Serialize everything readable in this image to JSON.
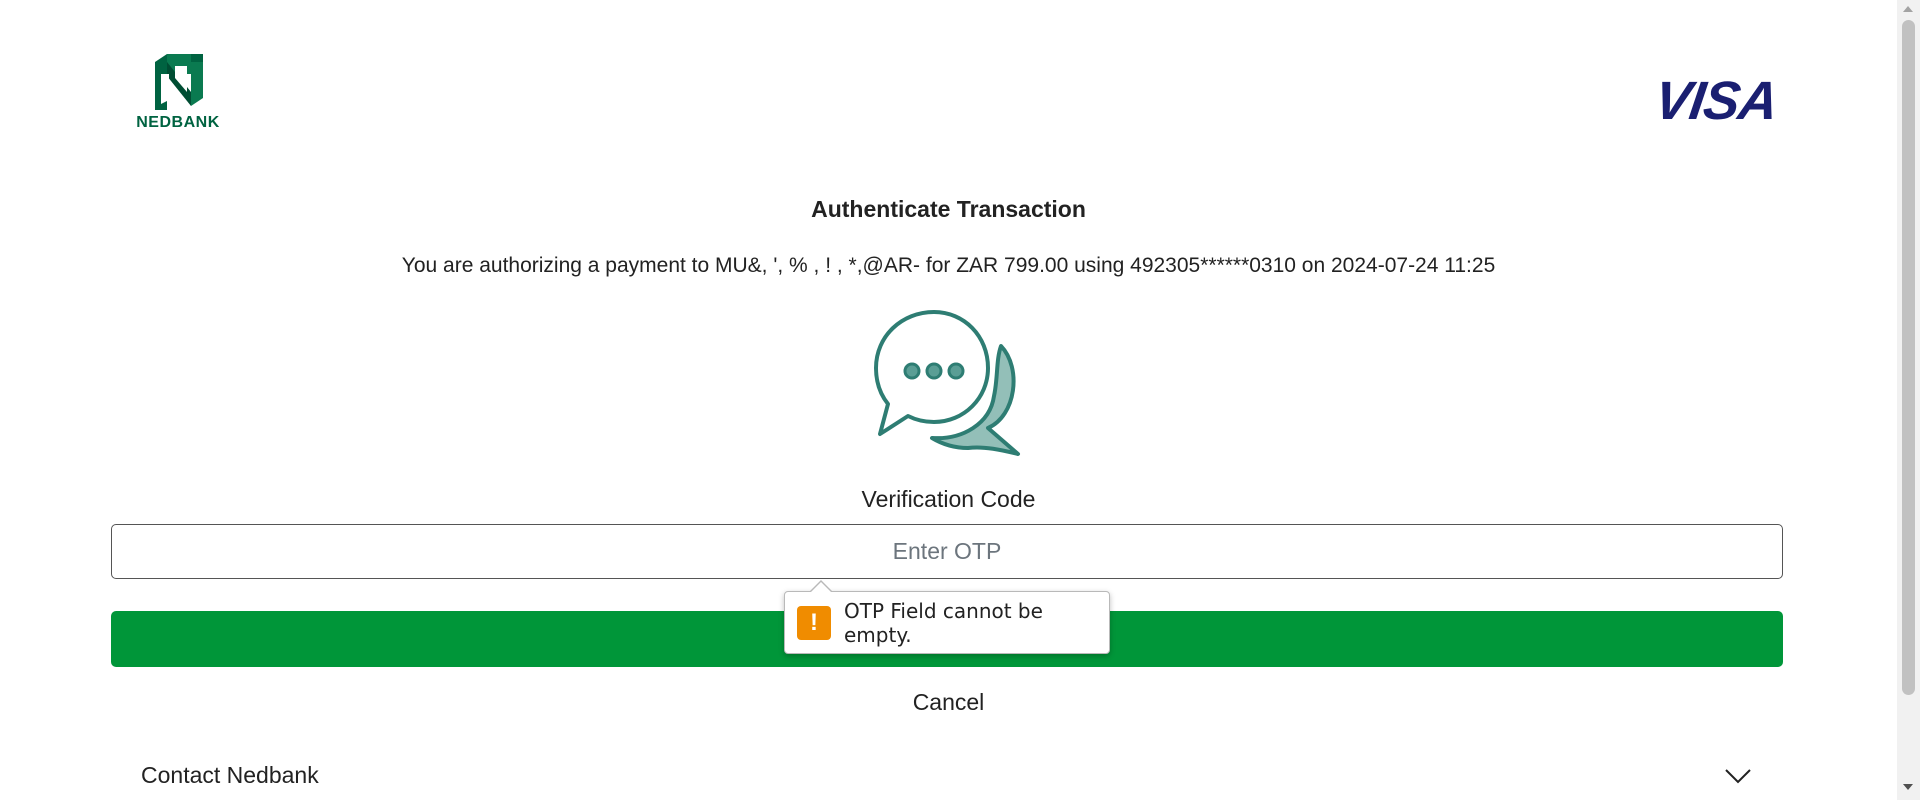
{
  "header": {
    "bank_logo_text": "NEDBANK",
    "card_network_logo_text": "VISA"
  },
  "main": {
    "title": "Authenticate Transaction",
    "description": "You are authorizing a payment to MU&, ', % , ! , *,@AR- for ZAR 799.00 using 492305******0310 on 2024-07-24 11:25",
    "illustration_icon": "chat-bubbles-icon",
    "verification_label": "Verification Code",
    "otp_placeholder": "Enter OTP",
    "otp_value": "",
    "submit_label": "",
    "validation_message": "OTP Field cannot be empty.",
    "cancel_label": "Cancel"
  },
  "footer": {
    "contact_label": "Contact Nedbank"
  },
  "colors": {
    "brand_green": "#006341",
    "button_green": "#009639",
    "visa_blue": "#1a1f71",
    "illustration_teal": "#2e7d73",
    "illustration_fill": "#93bfb8",
    "warning_orange": "#f08c00"
  }
}
